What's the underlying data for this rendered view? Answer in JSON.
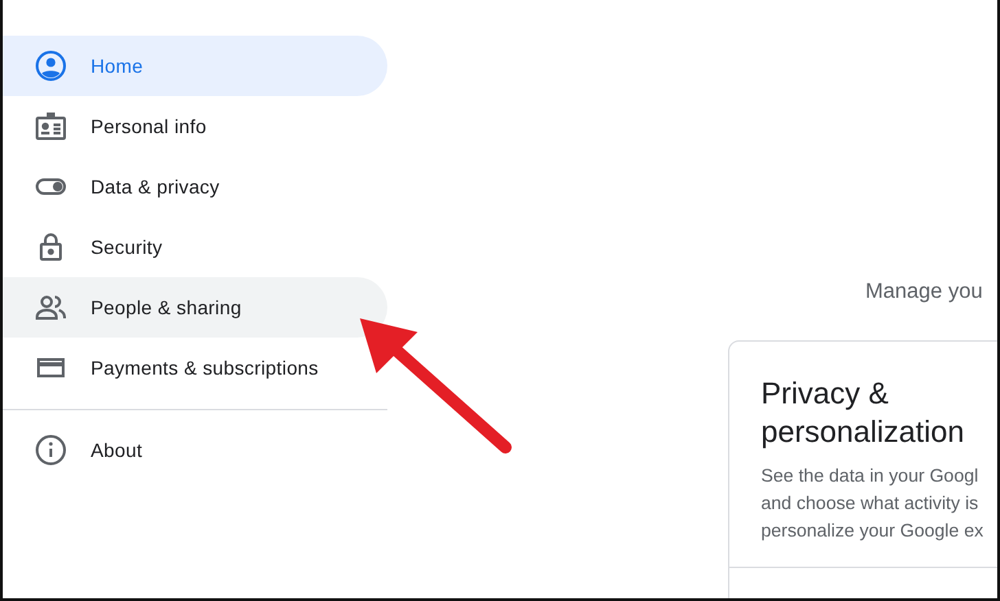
{
  "sidebar": {
    "items": [
      {
        "label": "Home",
        "selected": true,
        "hovered": false
      },
      {
        "label": "Personal info",
        "selected": false,
        "hovered": false
      },
      {
        "label": "Data & privacy",
        "selected": false,
        "hovered": false
      },
      {
        "label": "Security",
        "selected": false,
        "hovered": false
      },
      {
        "label": "People & sharing",
        "selected": false,
        "hovered": true
      },
      {
        "label": "Payments & subscriptions",
        "selected": false,
        "hovered": false
      }
    ],
    "footer_items": [
      {
        "label": "About",
        "selected": false,
        "hovered": false
      }
    ]
  },
  "main": {
    "intro": "Manage you",
    "card": {
      "title": "Privacy & personalization",
      "description": [
        "See the data in your Googl",
        "and choose what activity is",
        "personalize your Google ex"
      ]
    }
  }
}
